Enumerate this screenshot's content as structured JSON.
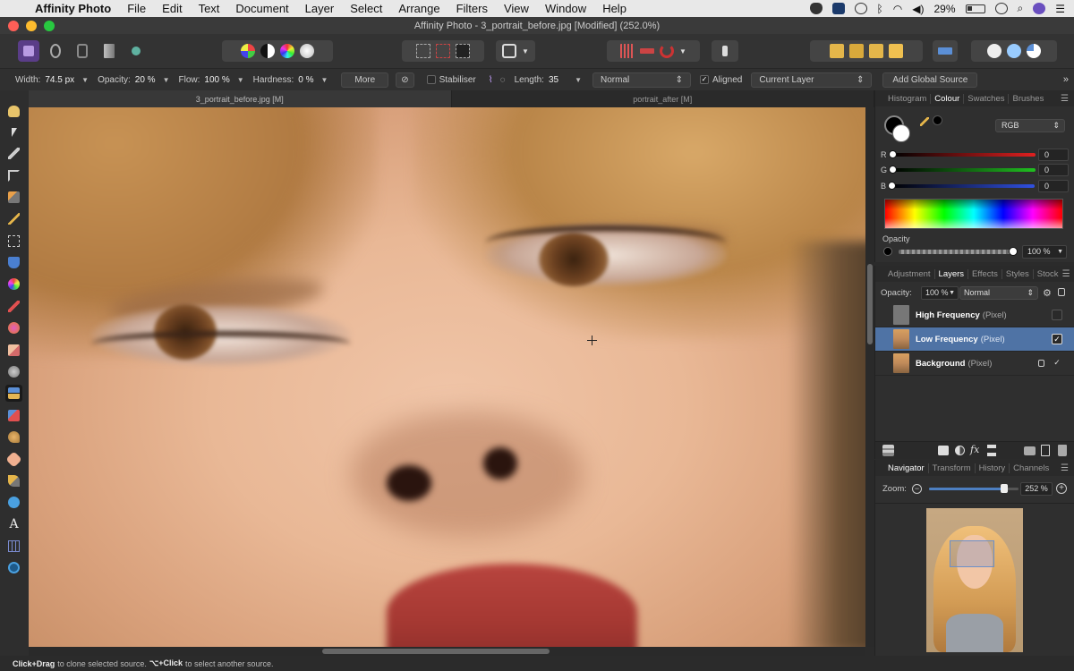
{
  "menubar": {
    "app_name": "Affinity Photo",
    "items": [
      "File",
      "Edit",
      "Text",
      "Document",
      "Layer",
      "Select",
      "Arrange",
      "Filters",
      "View",
      "Window",
      "Help"
    ],
    "battery": "29%",
    "status_icons": [
      "shield-icon",
      "dropbox-icon",
      "clock-icon",
      "bluetooth-icon",
      "wifi-icon",
      "volume-icon",
      "time-machine-icon",
      "search-icon",
      "siri-icon",
      "menu-list-icon"
    ]
  },
  "window": {
    "title": "Affinity Photo - 3_portrait_before.jpg [Modified] (252.0%)"
  },
  "context_toolbar": {
    "width_label": "Width:",
    "width_value": "74.5 px",
    "opacity_label": "Opacity:",
    "opacity_value": "20 %",
    "flow_label": "Flow:",
    "flow_value": "100 %",
    "hardness_label": "Hardness:",
    "hardness_value": "0 %",
    "more_label": "More",
    "stabiliser_label": "Stabiliser",
    "length_label": "Length:",
    "length_value": "35",
    "blend_mode": "Normal",
    "aligned_label": "Aligned",
    "source_mode": "Current Layer",
    "add_global_source_label": "Add Global Source"
  },
  "documents": {
    "tabs": [
      "3_portrait_before.jpg [M]",
      "portrait_after [M]"
    ]
  },
  "colour_panel": {
    "tabs": [
      "Histogram",
      "Colour",
      "Swatches",
      "Brushes"
    ],
    "active_tab": "Colour",
    "model": "RGB",
    "r_label": "R",
    "r_value": "0",
    "g_label": "G",
    "g_value": "0",
    "b_label": "B",
    "b_value": "0",
    "opacity_label": "Opacity",
    "opacity_value": "100 %"
  },
  "layers_panel": {
    "tabs": [
      "Adjustment",
      "Layers",
      "Effects",
      "Styles",
      "Stock"
    ],
    "active_tab": "Layers",
    "opacity_label": "Opacity:",
    "opacity_value": "100 %",
    "blend_mode": "Normal",
    "layers": [
      {
        "name": "High Frequency",
        "type": "(Pixel)",
        "visible": false,
        "selected": false,
        "locked": false
      },
      {
        "name": "Low Frequency",
        "type": "(Pixel)",
        "visible": true,
        "selected": true,
        "locked": false
      },
      {
        "name": "Background",
        "type": "(Pixel)",
        "visible": true,
        "selected": false,
        "locked": true
      }
    ]
  },
  "navigator_panel": {
    "tabs": [
      "Navigator",
      "Transform",
      "History",
      "Channels"
    ],
    "active_tab": "Navigator",
    "zoom_label": "Zoom:",
    "zoom_value": "252 %",
    "zoom_fraction": 0.84
  },
  "statusbar": {
    "a1": "Click+Drag",
    "t1": "to clone selected source.",
    "a2": "⌥+Click",
    "t2": "to select another source."
  },
  "colors": {
    "accent": "#4d7fc1",
    "selected_layer": "#4f73a5",
    "panel_bg": "#2f2f2f"
  }
}
